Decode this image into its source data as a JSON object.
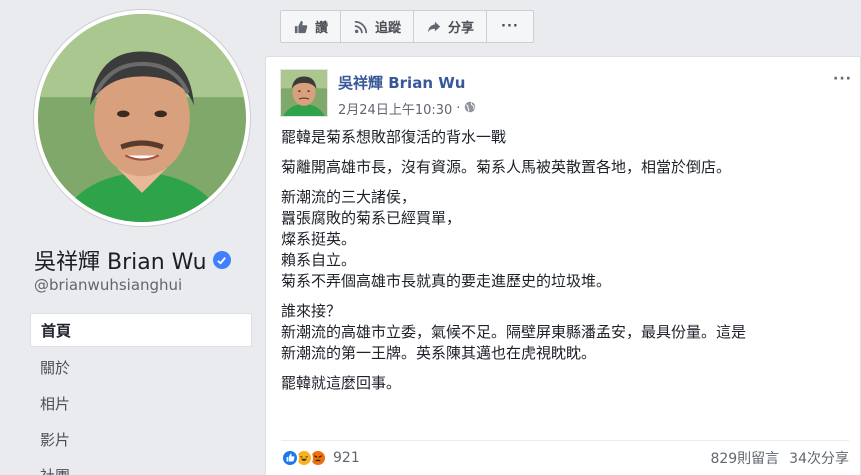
{
  "profile": {
    "name": "吳祥輝 Brian Wu",
    "handle": "@brianwuhsianghui",
    "verified": true
  },
  "nav": [
    {
      "label": "首頁",
      "active": true
    },
    {
      "label": "關於",
      "active": false
    },
    {
      "label": "相片",
      "active": false
    },
    {
      "label": "影片",
      "active": false
    },
    {
      "label": "社團",
      "active": false
    }
  ],
  "actions": {
    "like_label": "讚",
    "follow_label": "追蹤",
    "share_label": "分享",
    "more_label": "···"
  },
  "post": {
    "author": "吳祥輝 Brian Wu",
    "timestamp": "2月24日上午10:30",
    "audience_icon": "globe-icon",
    "menu_label": "···",
    "paragraphs": [
      [
        "罷韓是菊系想敗部復活的背水一戰"
      ],
      [
        "菊離開高雄市長，沒有資源。菊系人馬被英散置各地，相當於倒店。"
      ],
      [
        "新潮流的三大諸侯，",
        "囂張腐敗的菊系已經買單，",
        "燦系挺英。",
        "賴系自立。",
        "菊系不弄個高雄市長就真的要走進歷史的垃圾堆。"
      ],
      [
        "誰來接？",
        "新潮流的高雄市立委，氣候不足。隔壁屏東縣潘孟安，最具份量。這是",
        "新潮流的第一王牌。英系陳其邁也在虎視眈眈。"
      ],
      [
        "罷韓就這麼回事。"
      ]
    ],
    "reactions_count": "921",
    "comments_label": "829則留言",
    "shares_label": "34次分享"
  },
  "colors": {
    "background": "#e9ebee",
    "link": "#385898",
    "verified": "#4080ff",
    "like": "#1877f2",
    "haha": "#f7b125",
    "angry": "#e9710f"
  }
}
